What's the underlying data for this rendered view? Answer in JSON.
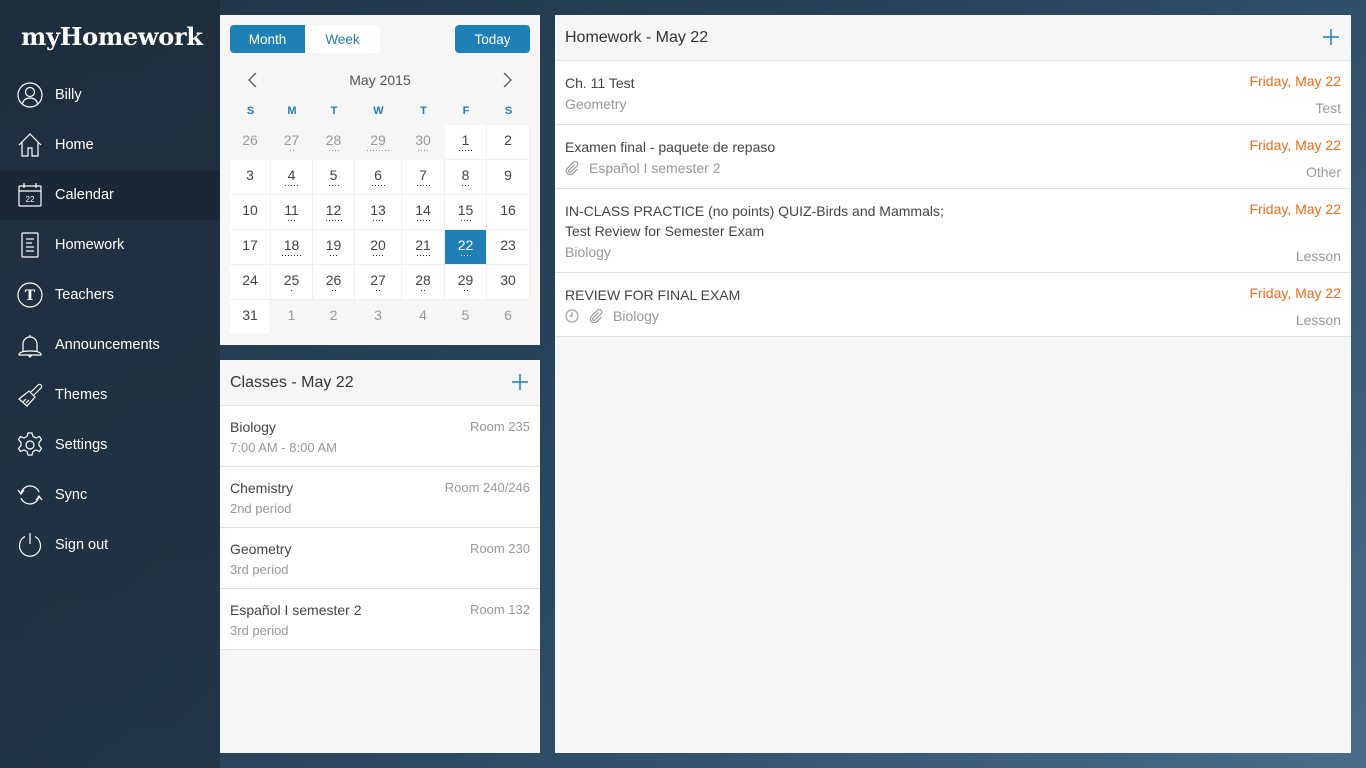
{
  "app": {
    "logo_bold": "myHomework"
  },
  "sidebar": {
    "items": [
      {
        "label": "Billy",
        "icon": "user-icon"
      },
      {
        "label": "Home",
        "icon": "home-icon"
      },
      {
        "label": "Calendar",
        "icon": "calendar-icon",
        "active": true,
        "icon_text": "22"
      },
      {
        "label": "Homework",
        "icon": "document-icon"
      },
      {
        "label": "Teachers",
        "icon": "teacher-icon",
        "icon_text": "T"
      },
      {
        "label": "Announcements",
        "icon": "bell-icon"
      },
      {
        "label": "Themes",
        "icon": "paintbrush-icon"
      },
      {
        "label": "Settings",
        "icon": "gear-icon"
      },
      {
        "label": "Sync",
        "icon": "sync-icon"
      },
      {
        "label": "Sign out",
        "icon": "power-icon"
      }
    ]
  },
  "calendar": {
    "view_toggle": {
      "month": "Month",
      "week": "Week",
      "selected": "Month"
    },
    "today_label": "Today",
    "month_label": "May 2015",
    "weekdays": [
      "S",
      "M",
      "T",
      "W",
      "T",
      "F",
      "S"
    ],
    "days": [
      {
        "d": "26",
        "other": true,
        "dots": 0
      },
      {
        "d": "27",
        "other": true,
        "dots": 2
      },
      {
        "d": "28",
        "other": true,
        "dots": 4
      },
      {
        "d": "29",
        "other": true,
        "dots": 8
      },
      {
        "d": "30",
        "other": true,
        "dots": 4
      },
      {
        "d": "1",
        "dots": 5
      },
      {
        "d": "2",
        "dots": 0
      },
      {
        "d": "3",
        "dots": 0
      },
      {
        "d": "4",
        "dots": 5
      },
      {
        "d": "5",
        "dots": 4
      },
      {
        "d": "6",
        "dots": 5
      },
      {
        "d": "7",
        "dots": 5
      },
      {
        "d": "8",
        "dots": 3
      },
      {
        "d": "9",
        "dots": 0
      },
      {
        "d": "10",
        "dots": 0
      },
      {
        "d": "11",
        "dots": 3
      },
      {
        "d": "12",
        "dots": 6
      },
      {
        "d": "13",
        "dots": 4
      },
      {
        "d": "14",
        "dots": 5
      },
      {
        "d": "15",
        "dots": 4
      },
      {
        "d": "16",
        "dots": 0
      },
      {
        "d": "17",
        "dots": 0
      },
      {
        "d": "18",
        "dots": 7
      },
      {
        "d": "19",
        "dots": 3
      },
      {
        "d": "20",
        "dots": 4
      },
      {
        "d": "21",
        "dots": 5
      },
      {
        "d": "22",
        "dots": 4,
        "selected": true
      },
      {
        "d": "23",
        "dots": 0
      },
      {
        "d": "24",
        "dots": 0
      },
      {
        "d": "25",
        "dots": 1
      },
      {
        "d": "26",
        "dots": 2
      },
      {
        "d": "27",
        "dots": 2
      },
      {
        "d": "28",
        "dots": 2
      },
      {
        "d": "29",
        "dots": 2
      },
      {
        "d": "30",
        "dots": 0
      },
      {
        "d": "31",
        "dots": 0
      },
      {
        "d": "1",
        "other": true,
        "dots": 0
      },
      {
        "d": "2",
        "other": true,
        "dots": 0
      },
      {
        "d": "3",
        "other": true,
        "dots": 0
      },
      {
        "d": "4",
        "other": true,
        "dots": 0
      },
      {
        "d": "5",
        "other": true,
        "dots": 0
      },
      {
        "d": "6",
        "other": true,
        "dots": 0
      }
    ]
  },
  "classes": {
    "title": "Classes - May 22",
    "items": [
      {
        "name": "Biology",
        "sub": "7:00 AM - 8:00 AM",
        "room": "Room 235"
      },
      {
        "name": "Chemistry",
        "sub": "2nd period",
        "room": "Room 240/246"
      },
      {
        "name": "Geometry",
        "sub": "3rd period",
        "room": "Room 230"
      },
      {
        "name": "Español I semester 2",
        "sub": "3rd period",
        "room": "Room 132"
      }
    ]
  },
  "homework": {
    "title": "Homework - May 22",
    "items": [
      {
        "title": "Ch. 11 Test",
        "class": "Geometry",
        "due": "Friday, May 22",
        "type": "Test",
        "attachment": false,
        "reminder": false
      },
      {
        "title": "Examen final - paquete de repaso",
        "class": "Español I semester 2",
        "due": "Friday, May 22",
        "type": "Other",
        "attachment": true,
        "reminder": false
      },
      {
        "title": "IN-CLASS PRACTICE (no points) QUIZ-Birds and Mammals;",
        "title2": "Test Review for Semester Exam",
        "class": "Biology",
        "due": "Friday, May 22",
        "type": "Lesson",
        "attachment": false,
        "reminder": false
      },
      {
        "title": "REVIEW FOR FINAL EXAM",
        "class": "Biology",
        "due": "Friday, May 22",
        "type": "Lesson",
        "attachment": true,
        "reminder": true
      }
    ]
  },
  "colors": {
    "accent": "#1f80b5",
    "due": "#f26b1d",
    "muted": "#999999"
  }
}
